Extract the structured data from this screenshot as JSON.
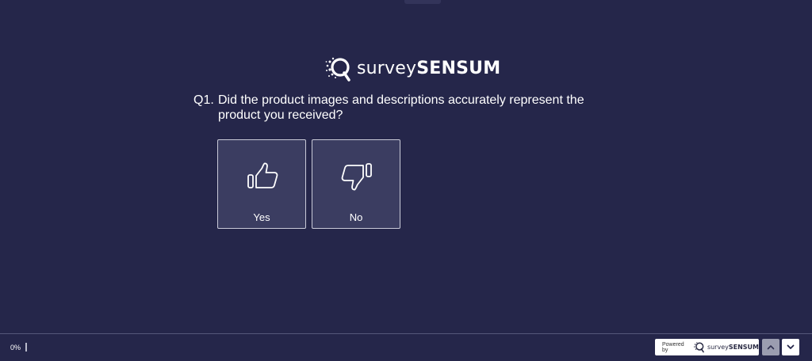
{
  "brand": {
    "logo_light": "survey",
    "logo_bold": "SENSUM",
    "logo_icon": "magnifier-logo-icon"
  },
  "question": {
    "number": "Q1.",
    "text": "Did the product images and descriptions accurately represent the product you received?"
  },
  "choices": [
    {
      "label": "Yes",
      "icon": "thumbs-up-icon"
    },
    {
      "label": "No",
      "icon": "thumbs-down-icon"
    }
  ],
  "footer": {
    "progress_label": "0%",
    "progress_value": 0,
    "powered_by": "Powered by",
    "powered_brand_light": "survey",
    "powered_brand_bold": "SENSUM",
    "prev_icon": "chevron-up-icon",
    "next_icon": "chevron-down-icon"
  },
  "colors": {
    "background": "#25264a",
    "choice_background": "#3b3d61",
    "choice_border": "#c9cad8",
    "text": "#ffffff"
  }
}
